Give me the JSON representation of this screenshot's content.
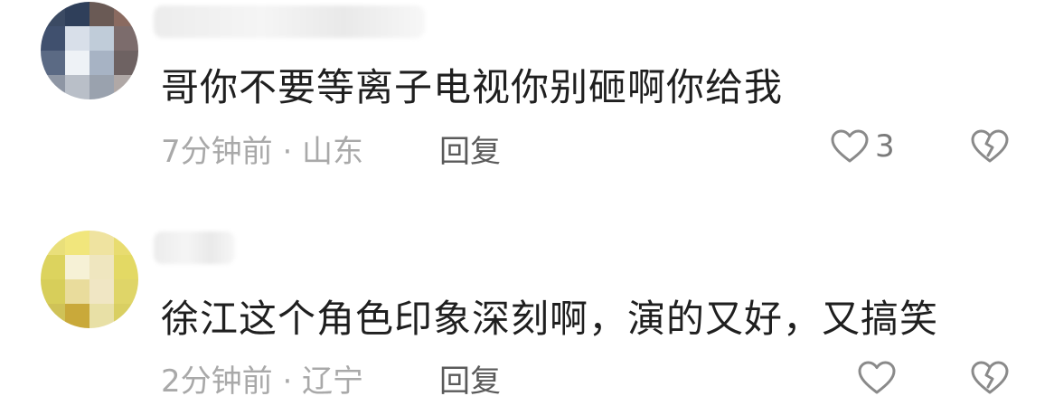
{
  "comments": [
    {
      "text": "哥你不要等离子电视你别砸啊你给我",
      "time_location": "7分钟前 · 山东",
      "reply_label": "回复",
      "like_count": "3",
      "avatar_colors": [
        "#3b4a63",
        "#2f3f5a",
        "#6a5a55",
        "#8a6a60",
        "#40506e",
        "#d8dfe9",
        "#c0ccd9",
        "#7c6c6c",
        "#5b6a84",
        "#eef2f6",
        "#a7b3c4",
        "#6e6262",
        "#8e96a4",
        "#b9bfc8",
        "#9aa2ae",
        "#b0a8a6"
      ]
    },
    {
      "text": "徐江这个角色印象深刻啊，演的又好，又搞笑",
      "time_location": "2分钟前 · 辽宁",
      "reply_label": "回复",
      "like_count": "",
      "avatar_colors": [
        "#e9df7a",
        "#f1e67c",
        "#efe3a0",
        "#e8dc70",
        "#dcd35e",
        "#f6f1d6",
        "#efe6bf",
        "#e3d964",
        "#d7ce5a",
        "#e9dc9c",
        "#f0e6c4",
        "#dfd568",
        "#cfc257",
        "#c9a93a",
        "#e8e0a6",
        "#d9cf62"
      ]
    }
  ],
  "icons": {
    "like": "heart-outline-icon",
    "dislike": "broken-heart-icon"
  },
  "colors": {
    "text": "#1f1f1f",
    "meta": "#a9a9a9",
    "reply": "#5a5a5a",
    "icon": "#8a8a8a"
  }
}
